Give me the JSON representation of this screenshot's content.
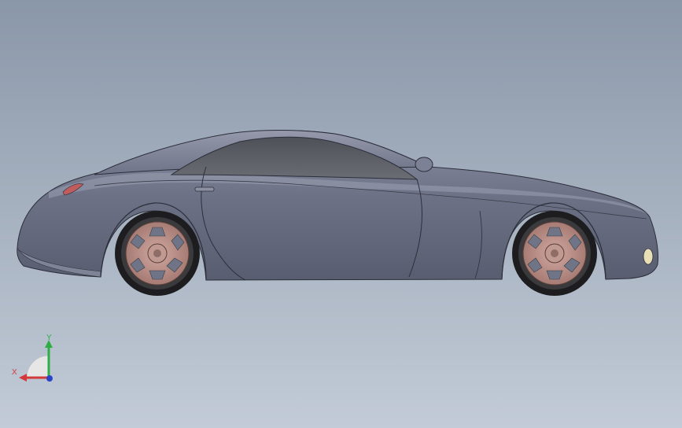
{
  "viewport": {
    "background_top": "#8a97a8",
    "background_bottom": "#c2cbd7"
  },
  "model": {
    "name": "car-model",
    "body_color": "#6f7486",
    "glass_color": "#55585f",
    "rim_color": "#b58a82",
    "tire_color": "#1d1d1f"
  },
  "triad": {
    "x_label": "X",
    "y_label": "Y",
    "x_color": "#d23a3a",
    "y_color": "#2fae46",
    "z_color": "#2a43c8"
  }
}
